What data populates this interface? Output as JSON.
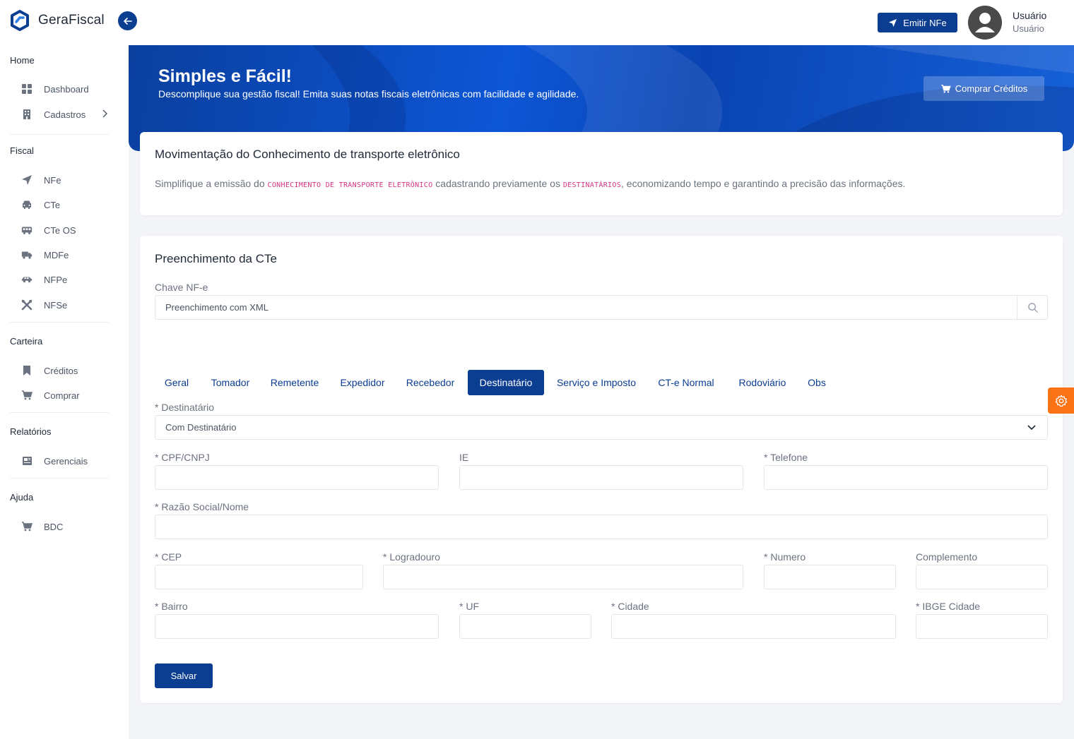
{
  "app": {
    "name": "GeraFiscal"
  },
  "header": {
    "emit_label": "Emitir NFe",
    "user_name": "Usuário",
    "user_role": "Usuário"
  },
  "sidebar": {
    "sections": [
      {
        "title": "Home",
        "items": [
          {
            "label": "Dashboard",
            "icon": "grid-icon"
          },
          {
            "label": "Cadastros",
            "icon": "building-icon"
          }
        ]
      },
      {
        "title": "Fiscal",
        "items": [
          {
            "label": "NFe",
            "icon": "send-icon"
          },
          {
            "label": "CTe",
            "icon": "car-icon"
          },
          {
            "label": "CTe OS",
            "icon": "bus-icon"
          },
          {
            "label": "MDFe",
            "icon": "truck-icon"
          },
          {
            "label": "NFPe",
            "icon": "car-side-icon"
          },
          {
            "label": "NFSe",
            "icon": "tools-icon"
          }
        ]
      },
      {
        "title": "Carteira",
        "items": [
          {
            "label": "Créditos",
            "icon": "bookmark-icon"
          },
          {
            "label": "Comprar",
            "icon": "cart-icon"
          }
        ]
      },
      {
        "title": "Relatórios",
        "items": [
          {
            "label": "Gerenciais",
            "icon": "newspaper-icon"
          }
        ]
      },
      {
        "title": "Ajuda",
        "items": [
          {
            "label": "BDC",
            "icon": "cart-icon"
          }
        ]
      }
    ]
  },
  "banner": {
    "title": "Simples e Fácil!",
    "subtitle": "Descomplique sua gestão fiscal! Emita suas notas fiscais eletrônicas com facilidade e agilidade.",
    "buy_label": "Comprar Créditos"
  },
  "info_card": {
    "title": "Movimentação do Conhecimento de transporte eletrônico",
    "desc_part1": "Simplifique a emissão do ",
    "code1": "CONHECIMENTO DE TRANSPORTE ELETRÔNICO",
    "desc_part2": " cadastrando previamente os ",
    "code2": "DESTINATÁRIOS",
    "desc_part3": ", economizando tempo e garantindo a precisão das informações."
  },
  "form": {
    "title": "Preenchimento da CTe",
    "chave_label": "Chave NF-e",
    "chave_placeholder": "Preenchimento com XML",
    "tabs": [
      "Geral",
      "Tomador",
      "Remetente",
      "Expedidor",
      "Recebedor",
      "Destinatário",
      "Serviço e Imposto",
      "CT-e Normal",
      "Rodoviário",
      "Obs"
    ],
    "active_tab": "Destinatário",
    "destinatario_label": "* Destinatário",
    "destinatario_value": "Com Destinatário",
    "fields": {
      "cpf": "* CPF/CNPJ",
      "ie": "IE",
      "telefone": "* Telefone",
      "razao": "* Razão Social/Nome",
      "cep": "* CEP",
      "logradouro": "* Logradouro",
      "numero": "* Numero",
      "complemento": "Complemento",
      "bairro": "* Bairro",
      "uf": "* UF",
      "cidade": "* Cidade",
      "ibge": "* IBGE Cidade"
    },
    "save_label": "Salvar"
  },
  "colors": {
    "primary": "#0b3d91",
    "accent": "#f97316",
    "code": "#d63384"
  }
}
